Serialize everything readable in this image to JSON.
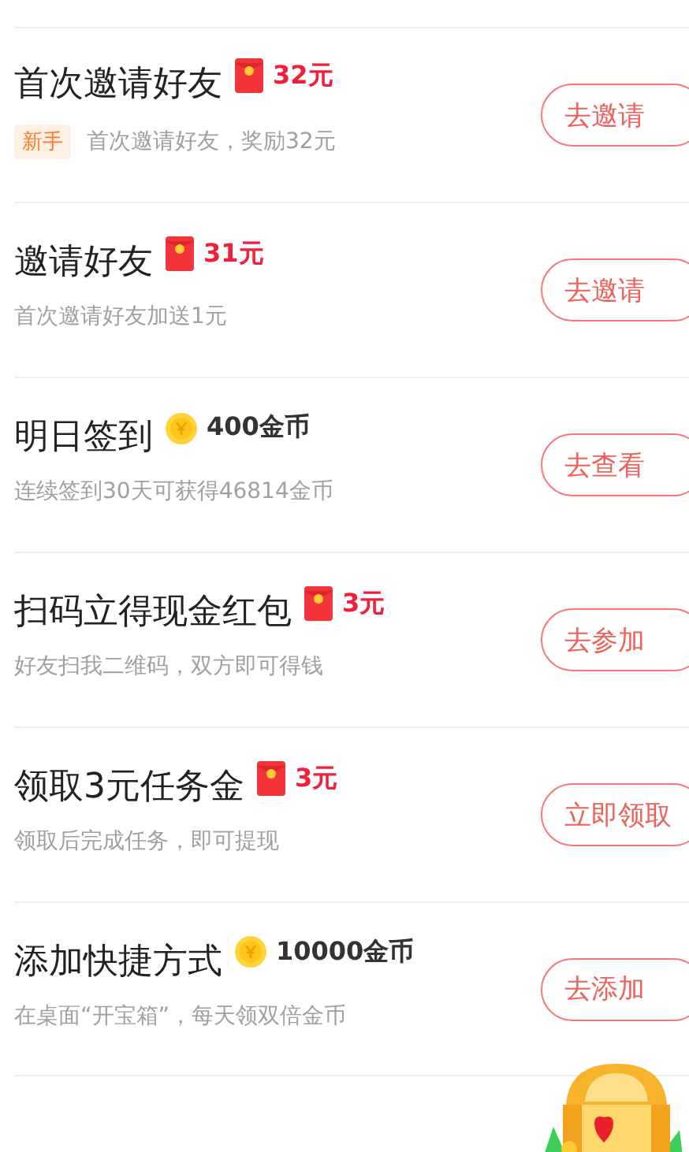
{
  "tasks": [
    {
      "title": "首次邀请好友",
      "reward": {
        "kind": "redpacket",
        "amount": "32元"
      },
      "tag": "新手",
      "subtitle": "首次邀请好友，奖励32元",
      "button": "去邀请"
    },
    {
      "title": "邀请好友",
      "reward": {
        "kind": "redpacket",
        "amount": "31元"
      },
      "subtitle": "首次邀请好友加送1元",
      "button": "去邀请"
    },
    {
      "title": "明日签到",
      "reward": {
        "kind": "coin",
        "amount": "400金币"
      },
      "subtitle": "连续签到30天可获得46814金币",
      "button": "去查看"
    },
    {
      "title": "扫码立得现金红包",
      "reward": {
        "kind": "redpacket",
        "amount": "3元"
      },
      "subtitle": "好友扫我二维码，双方即可得钱",
      "button": "去参加"
    },
    {
      "title": "领取3元任务金",
      "reward": {
        "kind": "redpacket",
        "amount": "3元"
      },
      "subtitle": "领取后完成任务，即可提现",
      "button": "立即领取"
    },
    {
      "title": "添加快捷方式",
      "reward": {
        "kind": "coin",
        "amount": "10000金币"
      },
      "subtitle": "在桌面“开宝箱”，每天领双倍金币",
      "button": "去添加"
    }
  ]
}
